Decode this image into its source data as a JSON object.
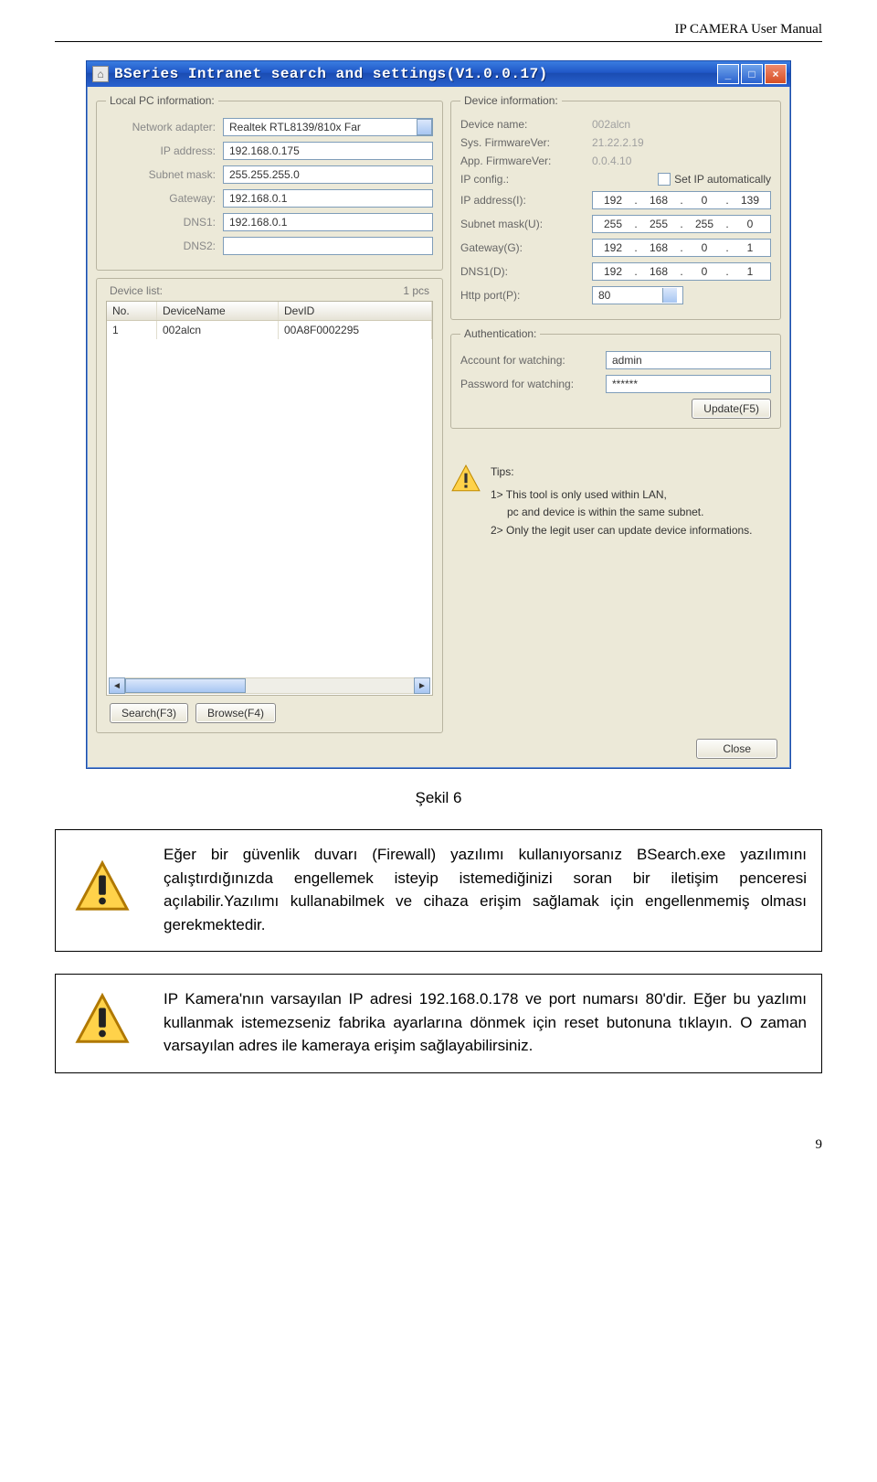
{
  "header": {
    "title": "IP CAMERA User Manual"
  },
  "window": {
    "title": "BSeries Intranet search and settings(V1.0.0.17)",
    "btn_min": "_",
    "btn_max": "□",
    "btn_close": "×"
  },
  "localpc": {
    "legend": "Local PC information:",
    "labels": {
      "adapter": "Network adapter:",
      "ip": "IP address:",
      "subnet": "Subnet mask:",
      "gateway": "Gateway:",
      "dns1": "DNS1:",
      "dns2": "DNS2:"
    },
    "values": {
      "adapter": "Realtek RTL8139/810x Far",
      "ip": "192.168.0.175",
      "subnet": "255.255.255.0",
      "gateway": "192.168.0.1",
      "dns1": "192.168.0.1",
      "dns2": ""
    }
  },
  "devlist": {
    "legend": "Device list:",
    "count": "1 pcs",
    "cols": {
      "no": "No.",
      "name": "DeviceName",
      "id": "DevID"
    },
    "row": {
      "no": "1",
      "name": "002alcn",
      "id": "00A8F0002295"
    },
    "scroll_left": "◄",
    "scroll_right": "►",
    "btn_search": "Search(F3)",
    "btn_browse": "Browse(F4)"
  },
  "devinfo": {
    "legend": "Device information:",
    "labels": {
      "devname": "Device name:",
      "sysfw": "Sys. FirmwareVer:",
      "appfw": "App. FirmwareVer:",
      "ipcfg": "IP config.:",
      "setauto": "Set IP automatically",
      "ip": "IP address(I):",
      "subnet": "Subnet mask(U):",
      "gateway": "Gateway(G):",
      "dns1": "DNS1(D):",
      "http": "Http port(P):"
    },
    "values": {
      "devname": "002alcn",
      "sysfw": "21.22.2.19",
      "appfw": "0.0.4.10",
      "ip": [
        "192",
        "168",
        "0",
        "139"
      ],
      "subnet": [
        "255",
        "255",
        "255",
        "0"
      ],
      "gateway": [
        "192",
        "168",
        "0",
        "1"
      ],
      "dns1": [
        "192",
        "168",
        "0",
        "1"
      ],
      "http": "80"
    }
  },
  "auth": {
    "legend": "Authentication:",
    "labels": {
      "acc": "Account for watching:",
      "pwd": "Password for watching:"
    },
    "values": {
      "acc": "admin",
      "pwd": "******"
    },
    "btn_update": "Update(F5)"
  },
  "tips": {
    "heading": "Tips:",
    "line1": "1> This tool is only used within LAN,",
    "line2": "pc and device is within the same subnet.",
    "line3": "2> Only the legit user can update  device informations."
  },
  "footer": {
    "btn_close": "Close"
  },
  "caption": "Şekil 6",
  "warn1": "Eğer bir güvenlik duvarı (Firewall) yazılımı kullanıyorsanız BSearch.exe yazılımını çalıştırdığınızda engellemek isteyip istemediğinizi soran bir iletişim penceresi açılabilir.Yazılımı kullanabilmek ve cihaza erişim sağlamak için engellenmemiş olması gerekmektedir.",
  "warn2": "IP Kamera'nın varsayılan IP adresi 192.168.0.178 ve port numarsı 80'dir. Eğer bu yazlımı kullanmak istemezseniz fabrika ayarlarına dönmek için reset butonuna tıklayın. O zaman varsayılan adres ile kameraya erişim sağlayabilirsiniz.",
  "page_number": "9"
}
